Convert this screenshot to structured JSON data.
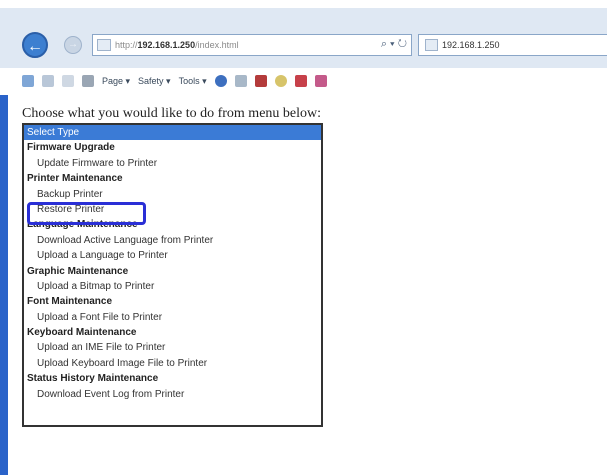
{
  "browser": {
    "address_prefix": "http://",
    "address_host": "192.168.1.250",
    "address_path": "/index.html",
    "address_controls": "⌕ ▾ ↻",
    "tab_title": "192.168.1.250",
    "command_bar": {
      "page_label": "Page ▾",
      "safety_label": "Safety ▾",
      "tools_label": "Tools ▾"
    }
  },
  "page": {
    "prompt": "Choose what you would like to do from menu below:",
    "menu": [
      {
        "label": "Select Type",
        "kind": "selected"
      },
      {
        "label": "Firmware Upgrade",
        "kind": "group"
      },
      {
        "label": "Update Firmware to Printer",
        "kind": "item"
      },
      {
        "label": "Printer Maintenance",
        "kind": "group"
      },
      {
        "label": "Backup Printer",
        "kind": "item"
      },
      {
        "label": "Restore Printer",
        "kind": "item"
      },
      {
        "label": "Language Maintenance",
        "kind": "group"
      },
      {
        "label": "Download Active Language from Printer",
        "kind": "item"
      },
      {
        "label": "Upload a Language to Printer",
        "kind": "item"
      },
      {
        "label": "Graphic Maintenance",
        "kind": "group"
      },
      {
        "label": "Upload a Bitmap to Printer",
        "kind": "item"
      },
      {
        "label": "Font Maintenance",
        "kind": "group"
      },
      {
        "label": "Upload a Font File to Printer",
        "kind": "item"
      },
      {
        "label": "Keyboard Maintenance",
        "kind": "group"
      },
      {
        "label": "Upload an IME File to Printer",
        "kind": "item"
      },
      {
        "label": "Upload Keyboard Image File to Printer",
        "kind": "item"
      },
      {
        "label": "Status History Maintenance",
        "kind": "group"
      },
      {
        "label": "Download Event Log from Printer",
        "kind": "item"
      }
    ]
  },
  "colors": {
    "selected_bg": "#3b7bd6",
    "highlight_border": "#2a2fd6",
    "left_accent": "#2a63c9"
  }
}
